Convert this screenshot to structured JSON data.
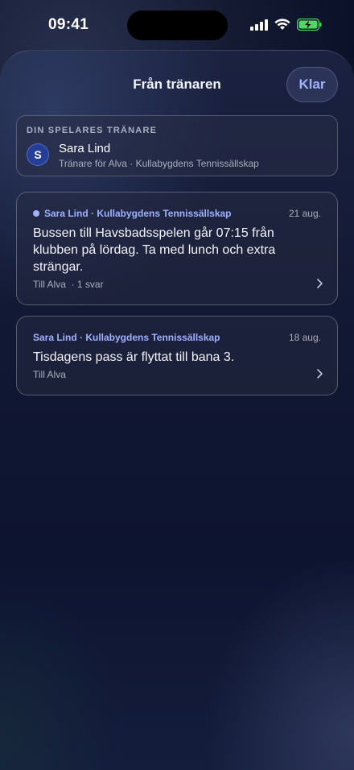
{
  "status_bar": {
    "time": "09:41",
    "icons": [
      "signal-icon",
      "wifi-icon",
      "battery-charging-icon"
    ]
  },
  "header": {
    "title": "Från tränaren",
    "done_label": "Klar"
  },
  "coach": {
    "heading": "DIN SPELARES TRÄNARE",
    "initial": "S",
    "name": "Sara Lind",
    "subtitle": "Tränare för Alva · Kullabygdens Tennissällskap"
  },
  "messages": [
    {
      "sender": "Sara Lind · Kullabygdens Tennissällskap",
      "date": "21 aug.",
      "unread": true,
      "body": "Bussen till Havsbadsspelen går 07:15 från klubben på lördag. Ta med lunch och extra strängar.",
      "meta": "Till Alva  · 1 svar"
    },
    {
      "sender": "Sara Lind · Kullabygdens Tennissällskap",
      "date": "18 aug.",
      "unread": false,
      "body": "Tisdagens pass är flyttat till bana 3.",
      "meta": "Till Alva"
    }
  ],
  "colors": {
    "accent": "#9fb2ff",
    "avatar": "#253e98",
    "battery": "#4cd964"
  }
}
